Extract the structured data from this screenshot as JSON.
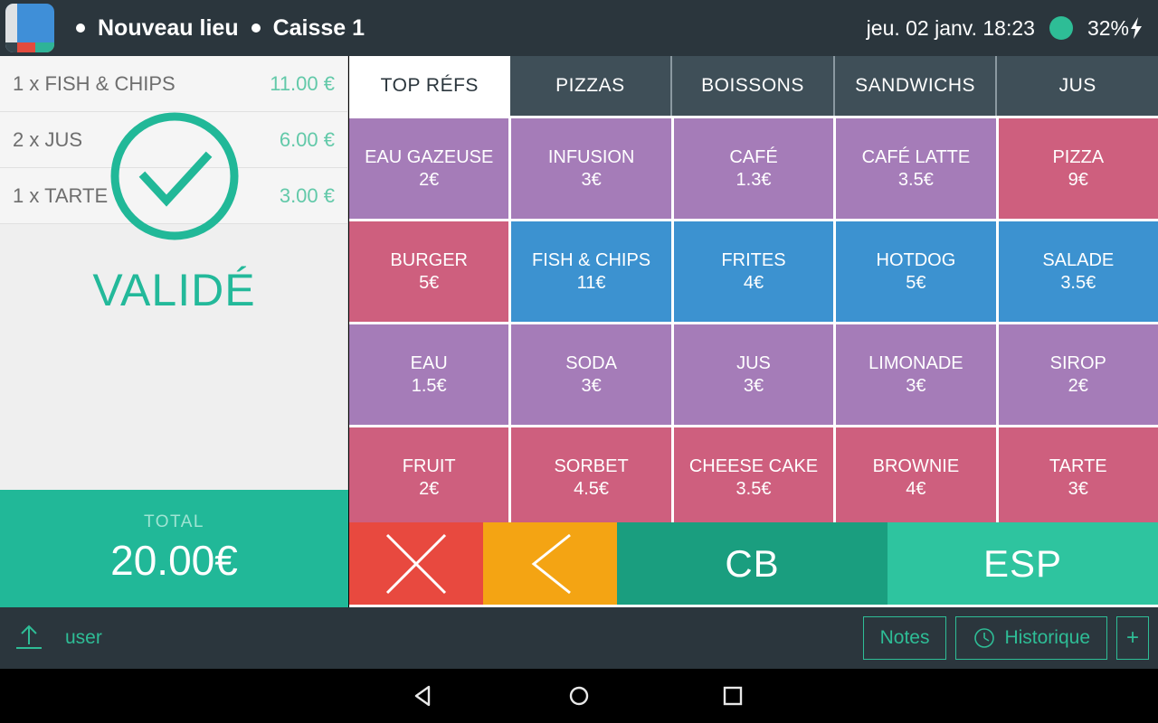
{
  "statusbar": {
    "logo_name": "app-logo",
    "venue": "Nouveau lieu",
    "register": "Caisse 1",
    "datetime": "jeu. 02 janv. 18:23",
    "battery": "32%",
    "battery_icon": "lightning-bolt-icon",
    "accent": "#2ebd96"
  },
  "order": {
    "lines": [
      {
        "label": "1 x FISH & CHIPS",
        "price": "11.00 €"
      },
      {
        "label": "2 x JUS",
        "price": "6.00 €"
      },
      {
        "label": "1 x TARTE",
        "price": "3.00 €"
      }
    ],
    "validated_label": "VALIDÉ",
    "validated_icon": "check-circle-icon",
    "total_label": "TOTAL",
    "total_amount": "20.00€",
    "total_color": "#21b898"
  },
  "catalog": {
    "tabs": [
      {
        "label": "TOP RÉFS",
        "active": true
      },
      {
        "label": "PIZZAS",
        "active": false
      },
      {
        "label": "BOISSONS",
        "active": false
      },
      {
        "label": "SANDWICHS",
        "active": false
      },
      {
        "label": "JUS",
        "active": false
      }
    ],
    "products": [
      {
        "name": "EAU GAZEUSE",
        "price": "2€",
        "color": "purple"
      },
      {
        "name": "INFUSION",
        "price": "3€",
        "color": "purple"
      },
      {
        "name": "CAFÉ",
        "price": "1.3€",
        "color": "purple"
      },
      {
        "name": "CAFÉ LATTE",
        "price": "3.5€",
        "color": "purple"
      },
      {
        "name": "PIZZA",
        "price": "9€",
        "color": "pink"
      },
      {
        "name": "BURGER",
        "price": "5€",
        "color": "pink"
      },
      {
        "name": "FISH & CHIPS",
        "price": "11€",
        "color": "blue"
      },
      {
        "name": "FRITES",
        "price": "4€",
        "color": "blue"
      },
      {
        "name": "HOTDOG",
        "price": "5€",
        "color": "blue"
      },
      {
        "name": "SALADE",
        "price": "3.5€",
        "color": "blue"
      },
      {
        "name": "EAU",
        "price": "1.5€",
        "color": "purple"
      },
      {
        "name": "SODA",
        "price": "3€",
        "color": "purple"
      },
      {
        "name": "JUS",
        "price": "3€",
        "color": "purple"
      },
      {
        "name": "LIMONADE",
        "price": "3€",
        "color": "purple"
      },
      {
        "name": "SIROP",
        "price": "2€",
        "color": "purple"
      },
      {
        "name": "FRUIT",
        "price": "2€",
        "color": "pink"
      },
      {
        "name": "SORBET",
        "price": "4.5€",
        "color": "pink"
      },
      {
        "name": "CHEESE CAKE",
        "price": "3.5€",
        "color": "pink"
      },
      {
        "name": "BROWNIE",
        "price": "4€",
        "color": "pink"
      },
      {
        "name": "TARTE",
        "price": "3€",
        "color": "pink"
      }
    ],
    "colors": {
      "purple": "#a57cb8",
      "blue": "#3c92d0",
      "pink": "#ce5f7e"
    }
  },
  "actions": {
    "cancel_icon": "close-x-icon",
    "back_icon": "chevron-left-icon",
    "cb_label": "CB",
    "esp_label": "ESP",
    "cancel_color": "#e8493f",
    "back_color": "#f4a413",
    "cb_color": "#1a9e7f",
    "esp_color": "#2ec49f"
  },
  "bottombar": {
    "logout_icon": "upload-arrow-icon",
    "user": "user",
    "notes_label": "Notes",
    "history_icon": "clock-icon",
    "history_label": "Historique",
    "add_label": "+"
  },
  "navbar": {
    "back": "back-triangle-icon",
    "home": "home-circle-icon",
    "recents": "recents-square-icon"
  }
}
